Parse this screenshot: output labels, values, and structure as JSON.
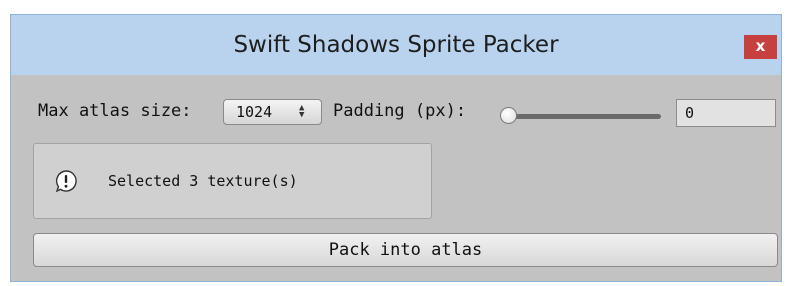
{
  "window": {
    "title": "Swift Shadows Sprite Packer",
    "close_label": "x"
  },
  "settings": {
    "max_atlas_label": "Max atlas size:",
    "max_atlas_value": "1024",
    "padding_label": "Padding (px):",
    "padding_value": "0",
    "padding_slider_fraction": 0
  },
  "help": {
    "icon": "info-bubble-icon",
    "message": "Selected 3 texture(s)"
  },
  "actions": {
    "pack_label": "Pack into atlas"
  },
  "colors": {
    "titlebar": "#b9d3ee",
    "panel": "#c2c2c2",
    "close_button": "#c74040"
  }
}
